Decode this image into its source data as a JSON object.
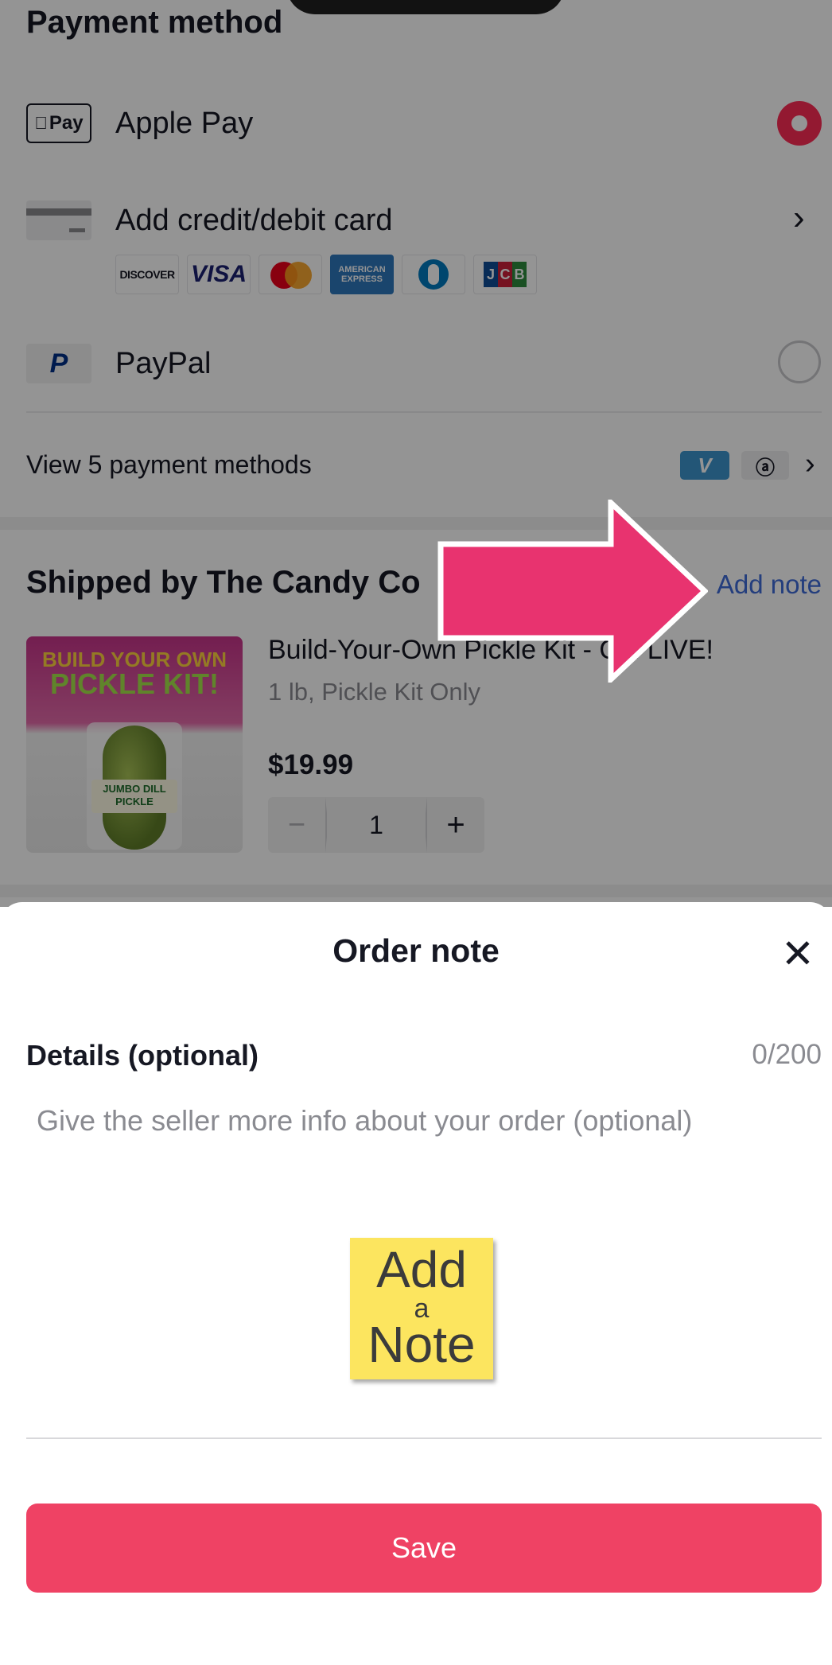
{
  "payment": {
    "title": "Payment method",
    "apple_pay": {
      "badge": "Pay",
      "label": "Apple Pay",
      "selected": true
    },
    "card": {
      "label": "Add credit/debit card",
      "chevron": "›",
      "brands": [
        "DISCOVER",
        "VISA",
        "mastercard",
        "AMERICAN EXPRESS",
        "Diners Club",
        "JCB"
      ]
    },
    "paypal": {
      "icon": "P",
      "label": "PayPal",
      "selected": false
    },
    "view_more": {
      "label": "View 5 payment methods",
      "badges": [
        "V",
        "ⓐ"
      ],
      "chevron": "›"
    }
  },
  "shipment": {
    "title": "Shipped by The Candy Co",
    "add_note": "Add note",
    "product": {
      "image_text_1": "BUILD YOUR OWN",
      "image_text_2": "PICKLE KIT!",
      "image_label": "JUMBO DILL PICKLE",
      "title": "Build-Your-Own Pickle Kit - ON LIVE!",
      "variant": "1 lb, Pickle Kit Only",
      "price": "$19.99",
      "quantity": "1",
      "minus": "−",
      "plus": "+"
    }
  },
  "sheet": {
    "title": "Order note",
    "close": "✕",
    "details_label": "Details (optional)",
    "counter": "0/200",
    "placeholder": "Give the seller more info about your order (optional)",
    "sticky_note": [
      "Add",
      "a",
      "Note"
    ],
    "save": "Save"
  },
  "colors": {
    "accent_red": "#fe2c55",
    "save_button": "#ef4264",
    "link_blue": "#3f6bd8",
    "arrow_pink": "#e8336f"
  },
  "icons": [
    "apple-pay-icon",
    "card-icon",
    "paypal-icon",
    "chevron-right-icon",
    "venmo-icon",
    "amazon-pay-icon",
    "close-icon",
    "pointer-arrow-icon"
  ]
}
